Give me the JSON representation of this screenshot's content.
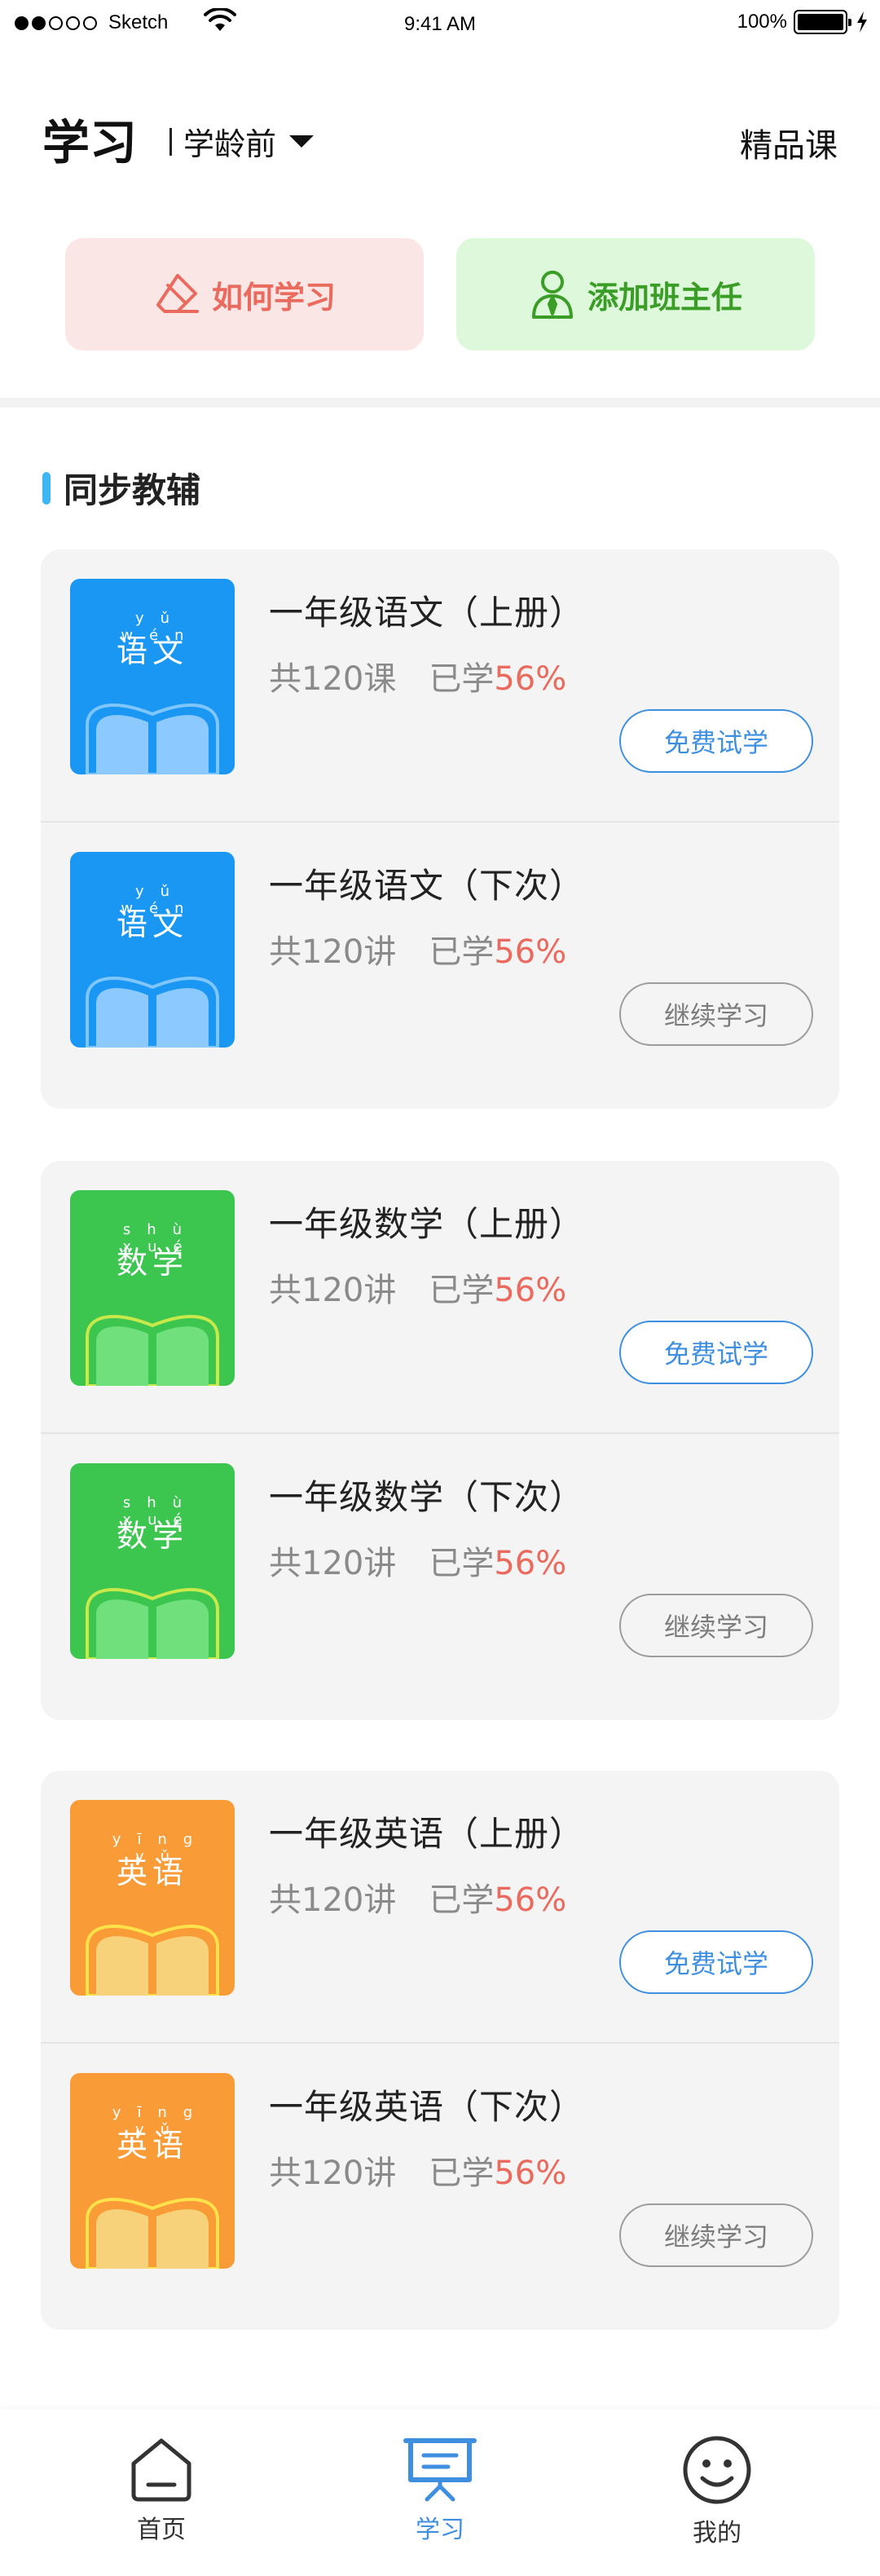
{
  "status_bar": {
    "carrier": "Sketch",
    "time": "9:41 AM",
    "battery_percent": "100%",
    "signal_bars_filled": 2,
    "signal_bars_total": 5
  },
  "header": {
    "title": "学习",
    "grade": "学龄前",
    "premium_link": "精品课"
  },
  "actions": {
    "how_to_learn": "如何学习",
    "add_teacher": "添加班主任"
  },
  "section": {
    "title": "同步教辅"
  },
  "colors": {
    "accent_blue": "#3f8fe0",
    "accent_red": "#ea6a5e",
    "chinese_cover": "#1a97f3",
    "math_cover": "#3cc650",
    "english_cover": "#f99b37"
  },
  "groups": [
    {
      "cover_pinyin": "yǔ wén",
      "cover_subject": "语文",
      "courses": [
        {
          "title": "一年级语文（上册）",
          "count": "共120课",
          "learned_label": "已学",
          "percent": "56%",
          "button": "免费试学"
        },
        {
          "title": "一年级语文（下次）",
          "count": "共120讲",
          "learned_label": "已学",
          "percent": "56%",
          "button": "继续学习"
        }
      ]
    },
    {
      "cover_pinyin": "shù xué",
      "cover_subject": "数学",
      "courses": [
        {
          "title": "一年级数学（上册）",
          "count": "共120讲",
          "learned_label": "已学",
          "percent": "56%",
          "button": "免费试学"
        },
        {
          "title": "一年级数学（下次）",
          "count": "共120讲",
          "learned_label": "已学",
          "percent": "56%",
          "button": "继续学习"
        }
      ]
    },
    {
      "cover_pinyin": "yīng yǔ",
      "cover_subject": "英语",
      "courses": [
        {
          "title": "一年级英语（上册）",
          "count": "共120讲",
          "learned_label": "已学",
          "percent": "56%",
          "button": "免费试学"
        },
        {
          "title": "一年级英语（下次）",
          "count": "共120讲",
          "learned_label": "已学",
          "percent": "56%",
          "button": "继续学习"
        }
      ]
    }
  ],
  "tabbar": {
    "home": "首页",
    "study": "学习",
    "mine": "我的",
    "active": "study"
  }
}
